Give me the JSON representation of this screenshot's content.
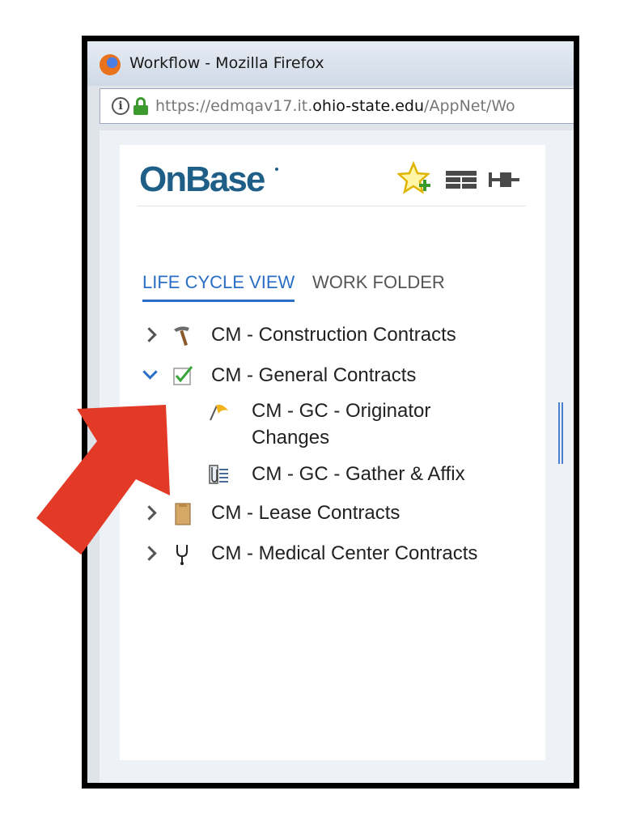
{
  "window": {
    "title": "Workflow - Mozilla Firefox",
    "url_prefix": "https://edmqav17.it.",
    "url_domain": "ohio-state.edu",
    "url_path": "/AppNet/Wo"
  },
  "header": {
    "logo": "OnBase"
  },
  "tabs": [
    {
      "label": "LIFE CYCLE VIEW",
      "active": true
    },
    {
      "label": "WORK FOLDER",
      "active": false
    }
  ],
  "tree": [
    {
      "label": "CM - Construction Contracts",
      "expanded": false,
      "icon": "hammer-icon"
    },
    {
      "label": "CM - General Contracts",
      "expanded": true,
      "icon": "checkbox-icon",
      "children": [
        {
          "label_line1": "CM - GC - Originator",
          "label_line2": "Changes",
          "icon": "flag-icon"
        },
        {
          "label": "CM - GC - Gather & Affix",
          "icon": "document-clip-icon"
        }
      ]
    },
    {
      "label": "CM - Lease Contracts",
      "expanded": false,
      "icon": "folder-envelope-icon"
    },
    {
      "label": "CM - Medical Center Contracts",
      "expanded": false,
      "icon": "stethoscope-icon"
    }
  ],
  "colors": {
    "accent": "#2b6ec6",
    "logo": "#1f5f87",
    "annotation_arrow": "#e23a27"
  }
}
